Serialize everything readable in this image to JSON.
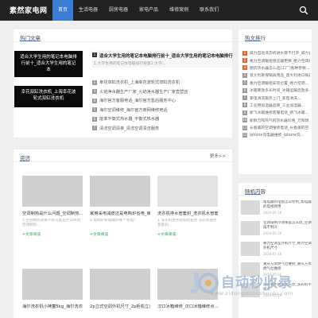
{
  "header": {
    "logo": "素然家电网",
    "nav": [
      "首页",
      "生活电器",
      "厨房电器",
      "家电产品",
      "维修案例",
      "联系我们"
    ]
  },
  "hot": {
    "title": "热门文章",
    "images": [
      {
        "lines": [
          "适合大学生用的笔记本电脑排",
          "行前十_适合大学生用的笔记本"
        ]
      },
      {
        "lines": [
          "幸花双缸洗衣机_上海幸花波",
          "轮式双缸洗衣机"
        ]
      }
    ],
    "feature": {
      "badge": "1",
      "title": "适合大学生用的笔记本电脑排行前十_适合大学生用的笔记本电脑排行",
      "desc": "1.大学生用的笔记本电脑排行榜第2.大学..."
    },
    "list": [
      {
        "num": "2",
        "text": "幸花双缸洗衣机_上海幸花波轮式双缸洗衣机"
      },
      {
        "num": "3",
        "text": "火焰净水器生产厂家_火焰净水器生产厂家直营店"
      },
      {
        "num": "4",
        "text": "海尔官方客服电话_海尔官方售后服务中心"
      },
      {
        "num": "5",
        "text": "海尔空调维修_海尔官方商网维修电话"
      },
      {
        "num": "6",
        "text": "能率平衡式热水器_平衡式热水器"
      },
      {
        "num": "7",
        "text": "清洁空调清单_清洁空调清洁服务"
      }
    ]
  },
  "news": {
    "title": "资讯",
    "more": "更多>>",
    "cards": [
      {
        "title": "空调制热是什么问题_空调制热...",
        "desc": "1.空调制热效果不好可能是什么原因 空调制热...",
        "tag": "+文章阅读"
      },
      {
        "title": "家用采电减皮还是电陶炉省电_家...",
        "desc": "1.电陶炉和电磁炉哪个省电?",
        "tag": "+文章阅读"
      },
      {
        "title": "洗衣机排水管套封_洗衣机水管套...",
        "desc": "1.洗衣机进水管如何套封 洗衣机进水管套封...",
        "tag": "+文章阅读"
      },
      {
        "title": "海尔洗衣机小神童5kg_海尔洗衣...",
        "desc": "",
        "tag": ""
      },
      {
        "title": "2p立式空调外机尺寸_2p柜机立式...",
        "desc": "",
        "tag": ""
      },
      {
        "title": "汉口冰箱维修_汉口冰箱维修点...",
        "desc": "",
        "tag": ""
      }
    ]
  },
  "ranking": {
    "title": "热文排行",
    "items": [
      {
        "num": "1",
        "text": "威力自动洗衣机进水键不打开_威力自动洗衣机..."
      },
      {
        "num": "2",
        "text": "格力空调暖组感应器更换_格力空调感应器..."
      },
      {
        "num": "3",
        "text": "厨房热水器怎么选(工厂)各种参数..."
      },
      {
        "num": "4",
        "text": "意大利斯保锅具用品_意大利进口锅具..."
      },
      {
        "num": "5",
        "text": "格力空调暖组安装位置_格力空调..."
      },
      {
        "num": "6",
        "text": "冰箱要放多长时间_冰箱运输后放多..."
      },
      {
        "num": "7",
        "text": "家电清洗服务上门_家电清洗..."
      },
      {
        "num": "8",
        "text": "工业用加湿器品牌_工业加湿器..."
      },
      {
        "num": "9",
        "text": "新飞冰箱维修客服电话_新飞冰箱..."
      },
      {
        "num": "10",
        "text": "新款万和热气机热水器价格_万和燃..."
      },
      {
        "num": "11",
        "text": "长春美的空调维修电话_长春美的空..."
      },
      {
        "num": "12",
        "text": "iphone充电器维修_iphone充..."
      }
    ]
  },
  "random": {
    "title": "随机内容",
    "items": [
      {
        "text": "帮电器的电视怎么停用_帮电器的电视停用",
        "date": "2024-05-16"
      },
      {
        "text": "空调扇制冷效果差怎么办_空调扇不制冷",
        "date": "2024-05-16"
      },
      {
        "text": "格力空调室外机尺寸_格力空调外机尺寸",
        "date": "2024-05-16"
      },
      {
        "text": "重庆方太燃气灶维修_重庆方太燃气灶维修",
        "date": "2024-05-16"
      },
      {
        "text": "洗衣机不脱水怎么办_洗衣机不排水",
        "date": "2024-05-16"
      }
    ]
  },
  "watermark": {
    "title": "自动秒收录",
    "sub": "www.zidongmiaoshoulu.com"
  },
  "colors": {
    "accent": "#3a7bd5",
    "rank_hot": "#e8662a",
    "rank_normal": "#999999",
    "tag_green": "#3aa05a"
  }
}
